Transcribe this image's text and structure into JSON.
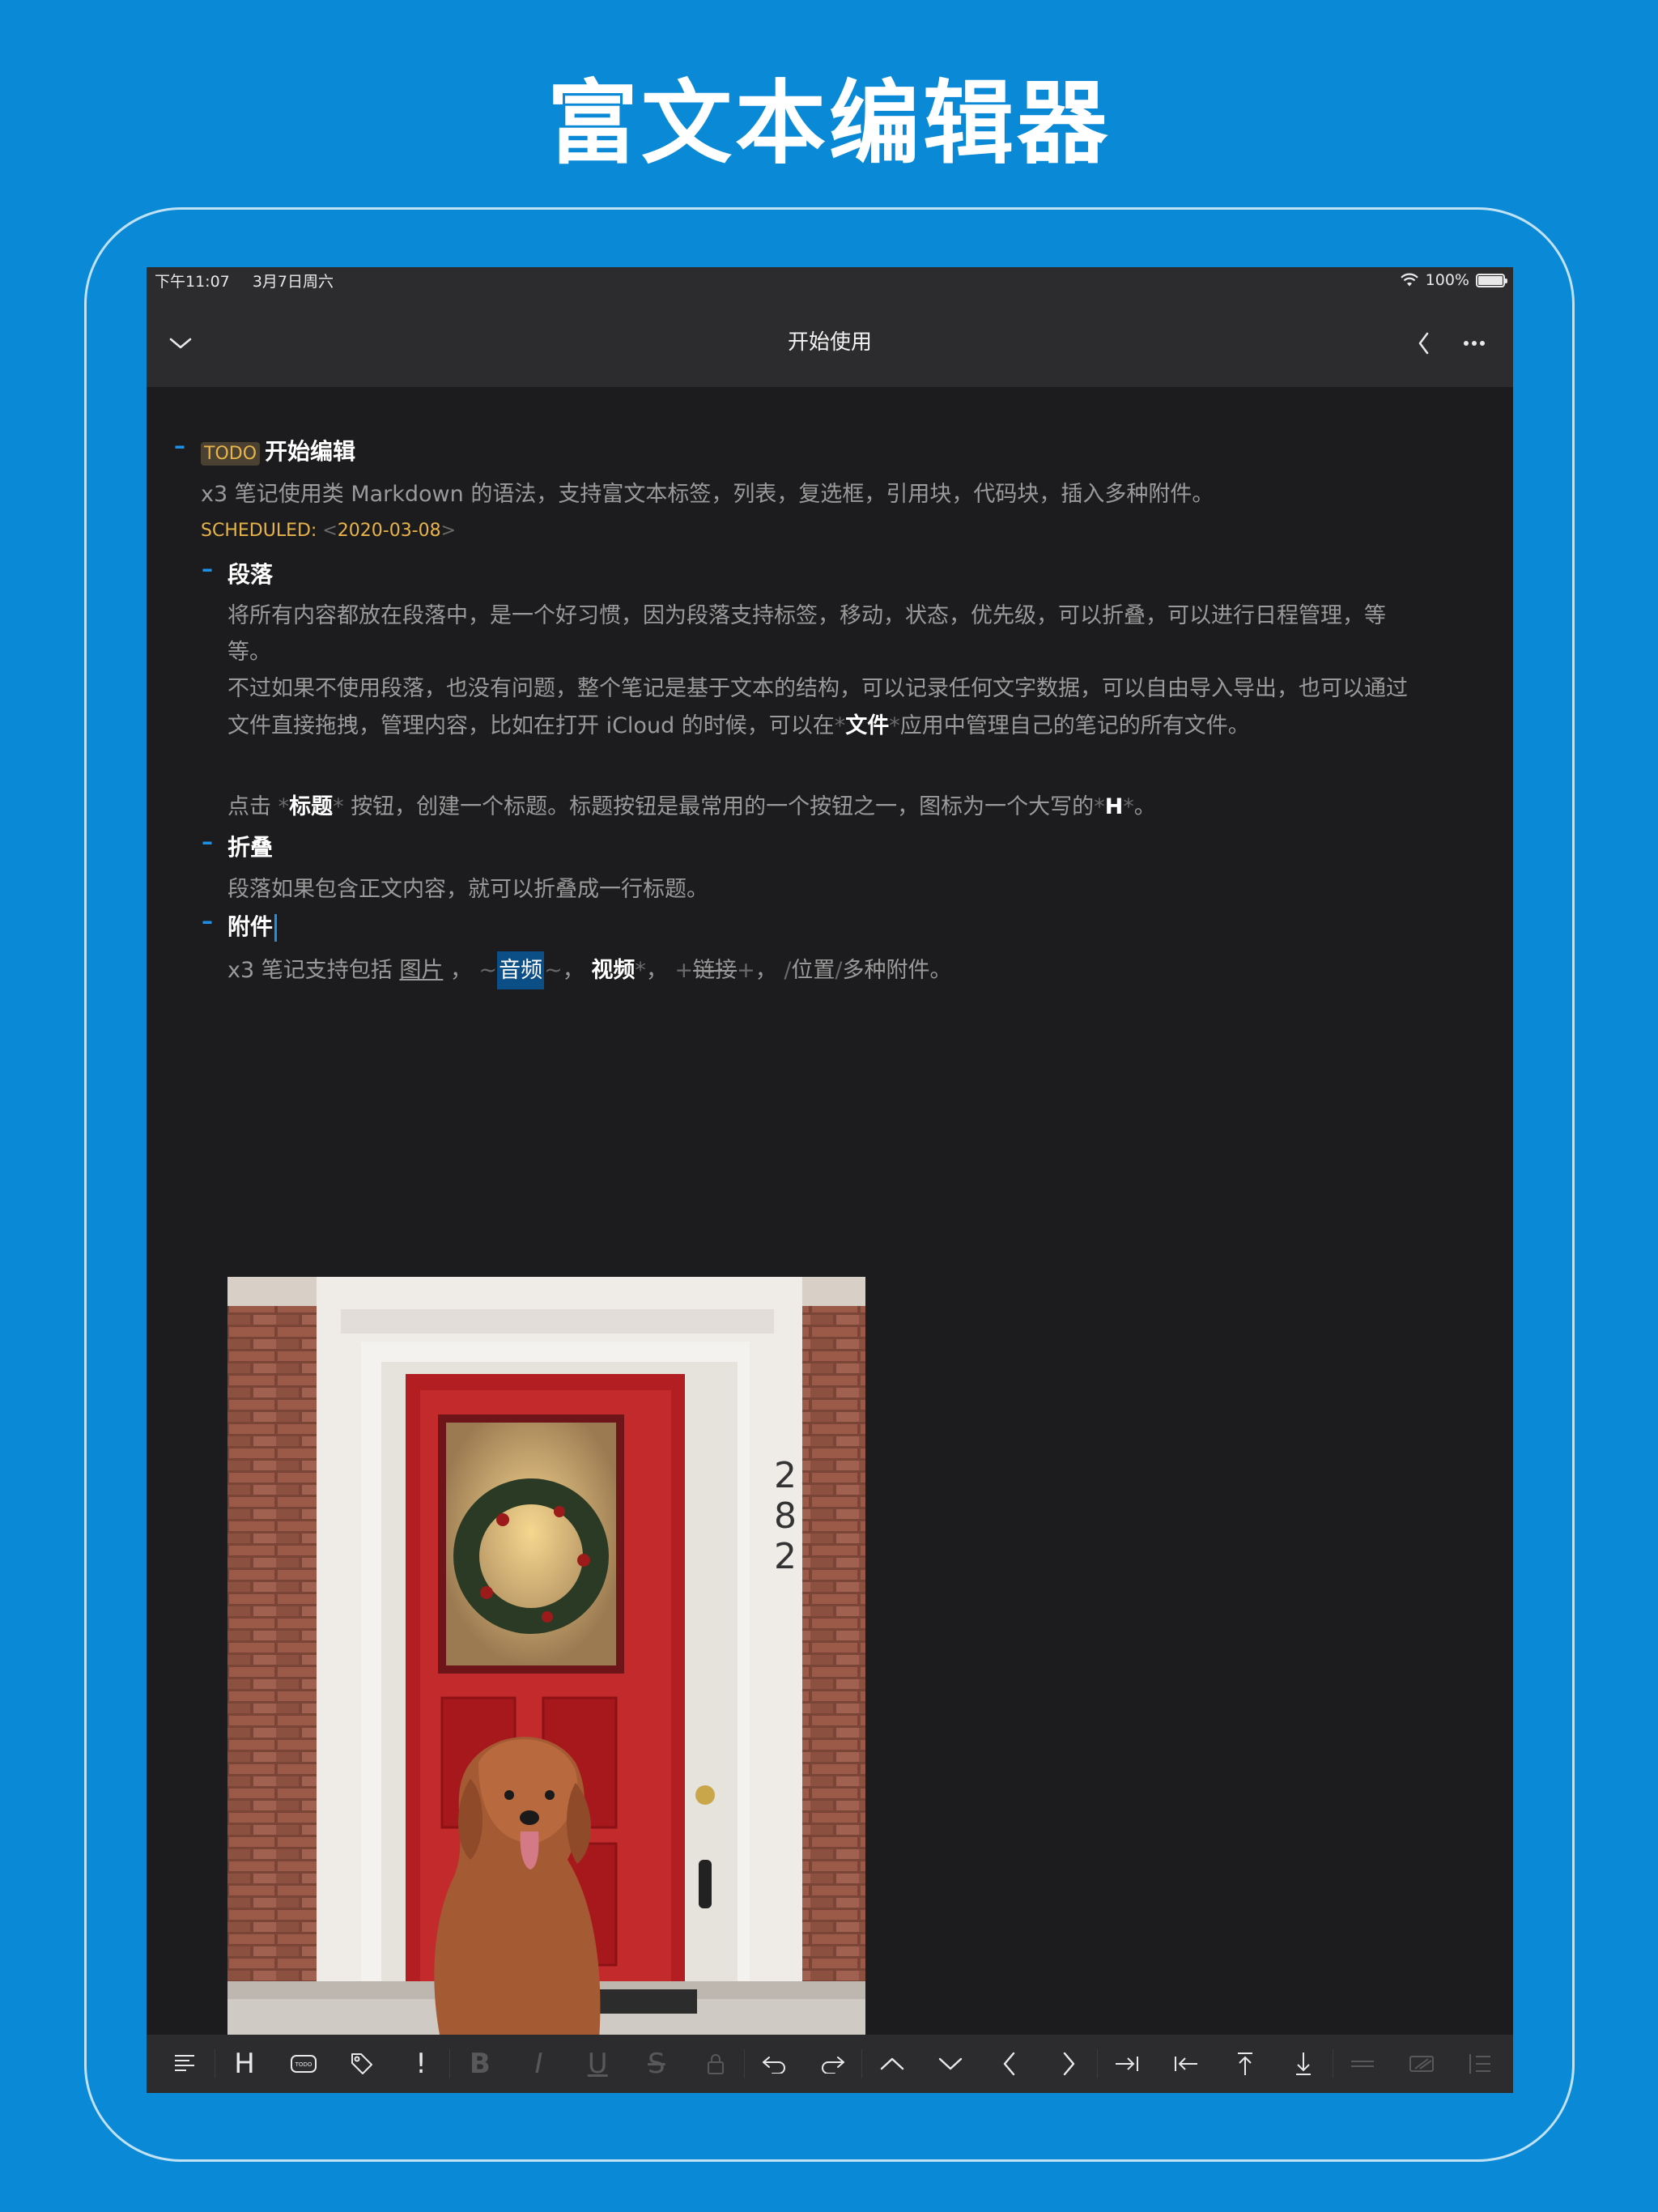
{
  "promo": {
    "title": "富文本编辑器"
  },
  "status_bar": {
    "time": "下午11:07",
    "date": "3月7日周六",
    "battery": "100%"
  },
  "nav": {
    "title": "开始使用"
  },
  "note": {
    "todo_label": "TODO",
    "heading1": "开始编辑",
    "intro": "x3 笔记使用类 Markdown 的语法，支持富文本标签，列表，复选框，引用块，代码块，插入多种附件。",
    "scheduled_label": "SCHEDULED:",
    "scheduled_date": "2020-03-08",
    "heading2": "段落",
    "para2_line1": "将所有内容都放在段落中，是一个好习惯，因为段落支持标签，移动，状态，优先级，可以折叠，可以进行日程管理，等",
    "para2_line2": "等。",
    "para2_line3": "不过如果不使用段落，也没有问题，整个笔记是基于文本的结构，可以记录任何文字数据，可以自由导入导出，也可以通过",
    "para2_line4_a": "文件直接拖拽，管理内容，比如在打开 iCloud 的时候，可以在",
    "para2_line4_bold": "文件",
    "para2_line4_b": "应用中管理自己的笔记的所有文件。",
    "para3_a": "点击",
    "para3_bold": "标题",
    "para3_b": "按钮，创建一个标题。标题按钮是最常用的一个按钮之一，图标为一个大写的",
    "para3_h": "H",
    "para3_end": "。",
    "heading3": "折叠",
    "para4": "段落如果包含正文内容，就可以折叠成一行标题。",
    "heading4": "附件",
    "para5_a": "x3 笔记支持包括",
    "para5_img": "图片",
    "para5_sep1": "，",
    "para5_audio": "音频",
    "para5_sep2": "，",
    "para5_video": "视频",
    "para5_sep3": "，",
    "para5_link": "链接",
    "para5_sep4": "，",
    "para5_loc": "位置",
    "para5_end": "多种附件。"
  },
  "toolbar": {
    "heading_label": "H",
    "todo_label": "TODO",
    "priority_label": "!",
    "bold_label": "B",
    "italic_label": "I",
    "underline_label": "U",
    "strike_label": "S"
  }
}
